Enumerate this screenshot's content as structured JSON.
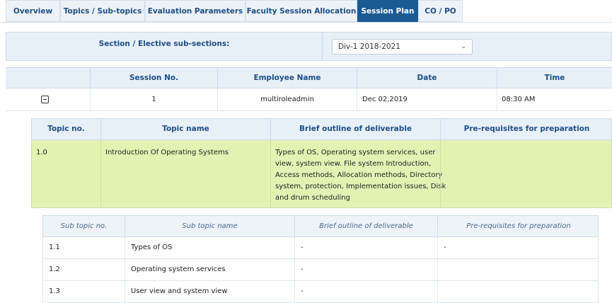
{
  "tabs": [
    {
      "label": "Overview",
      "active": false
    },
    {
      "label": "Topics / Sub-topics",
      "active": false
    },
    {
      "label": "Evaluation Parameters",
      "active": false
    },
    {
      "label": "Faculty Session Allocation",
      "active": false
    },
    {
      "label": "Session Plan",
      "active": true
    },
    {
      "label": "CO / PO",
      "active": false
    }
  ],
  "section": {
    "label": "Section / Elective sub-sections:",
    "selected": "Div-1 2018-2021"
  },
  "session_grid": {
    "headers": [
      "Session No.",
      "Employee Name",
      "Date",
      "Time"
    ],
    "row": {
      "session_no": "1",
      "employee": "multiroleadmin",
      "date": "Dec 02,2019",
      "time": "08:30 AM"
    }
  },
  "topics_table": {
    "headers": [
      "Topic no.",
      "Topic name",
      "Brief outline of deliverable",
      "Pre-requisites for preparation"
    ],
    "row": {
      "no": "1.0",
      "name": "Introduction Of Operating Systems",
      "outline_lines": [
        "Types of OS, Operating system services, user",
        "view, system view. File system Introduction,",
        "Access methods, Allocation methods, Directory",
        "system, protection, Implementation issues, Disk",
        "and drum scheduling"
      ],
      "prereq": ""
    }
  },
  "subtopics_table": {
    "headers": [
      "Sub topic no.",
      "Sub topic name",
      "Brief outline of deliverable",
      "Pre-requisites for preparation"
    ],
    "rows": [
      {
        "no": "1.1",
        "name": "Types of OS",
        "outline": "-",
        "prereq": "-"
      },
      {
        "no": "1.2",
        "name": "Operating system services",
        "outline": "-",
        "prereq": ""
      },
      {
        "no": "1.3",
        "name": "User view and system view",
        "outline": "-",
        "prereq": ""
      }
    ]
  },
  "icons": {
    "collapse": "minus-square-icon",
    "dropdown": "chevron-down-icon"
  },
  "colors": {
    "accent": "#1c5a94",
    "header_bg": "#e7eff8",
    "highlight_row": "#e2f2b3"
  }
}
